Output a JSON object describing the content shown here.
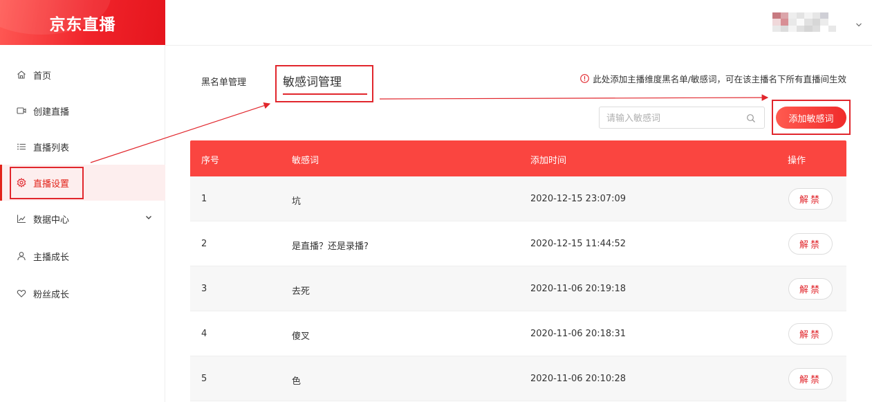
{
  "app": {
    "logo_text": "京东直播"
  },
  "sidebar": {
    "items": [
      {
        "label": "首页",
        "icon": "home-icon"
      },
      {
        "label": "创建直播",
        "icon": "video-camera-icon"
      },
      {
        "label": "直播列表",
        "icon": "list-icon"
      },
      {
        "label": "直播设置",
        "icon": "gear-icon",
        "active": true
      },
      {
        "label": "数据中心",
        "icon": "line-chart-icon",
        "expandable": true
      },
      {
        "label": "主播成长",
        "icon": "user-icon"
      },
      {
        "label": "粉丝成长",
        "icon": "heart-icon"
      }
    ]
  },
  "tabs": {
    "blacklist": "黑名单管理",
    "sensitive": "敏感词管理"
  },
  "notice": "此处添加主播维度黑名单/敏感词，可在该主播名下所有直播间生效",
  "search": {
    "placeholder": "请输入敏感词",
    "value": ""
  },
  "add_button": "添加敏感词",
  "table": {
    "headers": [
      "序号",
      "敏感词",
      "添加时间",
      "操作"
    ],
    "rows": [
      {
        "index": "1",
        "word": "坑",
        "time": "2020-12-15 23:07:09",
        "action": "解禁"
      },
      {
        "index": "2",
        "word": "是直播？还是录播?",
        "time": "2020-12-15 11:44:52",
        "action": "解禁"
      },
      {
        "index": "3",
        "word": "去死",
        "time": "2020-11-06 20:19:18",
        "action": "解禁"
      },
      {
        "index": "4",
        "word": "傻叉",
        "time": "2020-11-06 20:18:31",
        "action": "解禁"
      },
      {
        "index": "5",
        "word": "色",
        "time": "2020-11-06 20:10:28",
        "action": "解禁"
      }
    ]
  },
  "colors": {
    "brand": "#e1262c",
    "table_header": "#fa4540",
    "active_bg": "#fdeeee"
  }
}
